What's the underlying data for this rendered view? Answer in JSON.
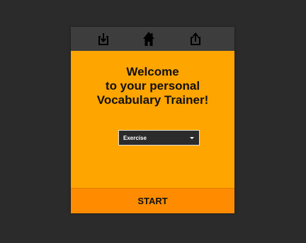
{
  "toolbar": {
    "icons": [
      "import-icon",
      "home-icon",
      "export-icon"
    ]
  },
  "welcome": {
    "line1": "Welcome",
    "line2": "to your personal",
    "line3": "Vocabulary Trainer!"
  },
  "mode_select": {
    "selected": "Exercise"
  },
  "start_button": {
    "label": "START"
  },
  "colors": {
    "background": "#2b2b2b",
    "toolbar": "#3d3d3d",
    "panel": "#ffa500",
    "start_button": "#ff8c00",
    "select_bg": "#2b2b2b"
  }
}
